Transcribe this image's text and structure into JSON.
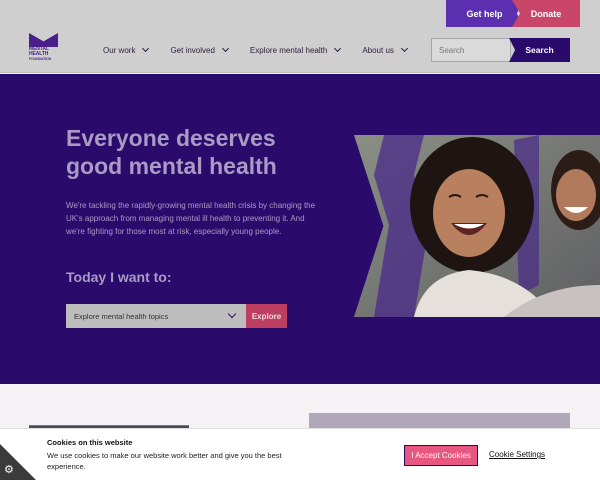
{
  "utility": {
    "get_help": "Get help",
    "donate": "Donate"
  },
  "logo": {
    "line1": "MENTAL",
    "line2": "HEALTH",
    "line3": "FOUNDATION"
  },
  "nav": {
    "items": [
      {
        "label": "Our work"
      },
      {
        "label": "Get involved"
      },
      {
        "label": "Explore mental health"
      },
      {
        "label": "About us"
      }
    ]
  },
  "search": {
    "placeholder": "Search",
    "button": "Search"
  },
  "hero": {
    "title": "Everyone deserves good mental health",
    "lead": "We're tackling the rapidly-growing mental health crisis by changing the UK's approach from managing mental ill health to preventing it. And we're fighting for those most at risk, especially young people.",
    "want_label": "Today I want to:",
    "select_value": "Explore mental health topics",
    "explore_button": "Explore"
  },
  "cookie": {
    "title": "Cookies on this website",
    "text": "We use cookies to make our website work better and give you the best experience.",
    "accept": "I Accept Cookies",
    "settings": "Cookie Settings"
  },
  "colors": {
    "brand_purple": "#2a0b6c",
    "accent_pink": "#c9456a",
    "get_help_purple": "#5b2fb0"
  },
  "icons": {
    "settings": "gear-icon",
    "dropdown": "chevron-down-icon"
  }
}
